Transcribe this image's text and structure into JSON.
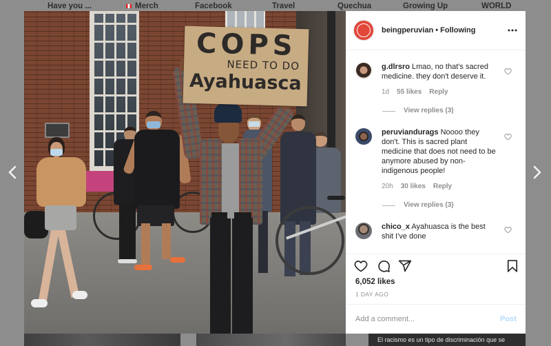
{
  "site_nav": {
    "items": [
      {
        "label": "Have you ..."
      },
      {
        "label": "Merch",
        "icon": "peru-flag-icon"
      },
      {
        "label": "Facebook"
      },
      {
        "label": "Travel"
      },
      {
        "label": "Quechua"
      },
      {
        "label": "Growing Up"
      },
      {
        "label": "WORLD"
      }
    ]
  },
  "gallery": {
    "prev_icon": "chevron-left-icon",
    "next_icon": "chevron-right-icon",
    "background_caption": "El racismo es un tipo de discriminación que se"
  },
  "post": {
    "photo": {
      "sign_lines": [
        "COPS",
        "NEED TO DO",
        "Ayahuasca"
      ]
    },
    "header": {
      "username": "beingperuvian",
      "separator": "•",
      "follow_status": "Following",
      "more_icon": "more-horizontal-icon"
    },
    "comments": [
      {
        "username": "g.dlrsro",
        "text": "Lmao, no that's sacred medicine. they don't deserve it.",
        "age": "1d",
        "likes": "55 likes",
        "reply_label": "Reply",
        "view_replies": "View replies (3)"
      },
      {
        "username": "peruviandurags",
        "text": "Noooo they don't. This is sacred plant medicine that does not need to be anymore abused by non-indigenous people!",
        "age": "20h",
        "likes": "30 likes",
        "reply_label": "Reply",
        "view_replies": "View replies (3)"
      },
      {
        "username": "chico_x",
        "text": "Ayahuasca is the best shit I've done"
      }
    ],
    "actions": {
      "like_icon": "heart-icon",
      "comment_icon": "comment-icon",
      "share_icon": "share-icon",
      "save_icon": "bookmark-icon"
    },
    "likes_count": "6,052 likes",
    "posted_ago": "1 DAY AGO",
    "add_comment": {
      "placeholder": "Add a comment...",
      "post_label": "Post"
    }
  },
  "colors": {
    "overlay": "#8d8d8d",
    "panel_bg": "#ffffff",
    "text_primary": "#262626",
    "text_secondary": "#8e8e8e",
    "post_button_disabled": "#b3dbff",
    "divider": "#efefef",
    "avatar_brand": "#e2473a"
  }
}
